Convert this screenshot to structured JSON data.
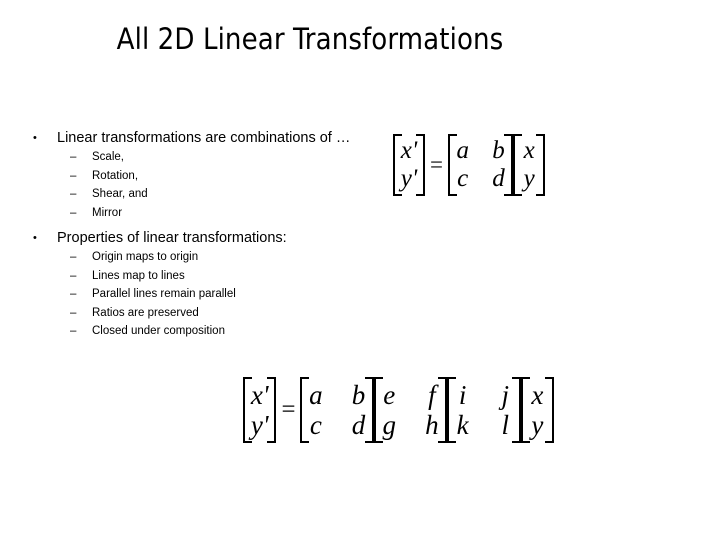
{
  "slide": {
    "title": "All 2D Linear Transformations",
    "bullets": [
      {
        "marker": "•",
        "text": "Linear transformations are combinations of …",
        "sub_marker": "–",
        "sub_items": [
          "Scale,",
          "Rotation,",
          "Shear, and",
          "Mirror"
        ]
      },
      {
        "marker": "•",
        "text": "Properties of linear transformations:",
        "sub_marker": "–",
        "sub_items": [
          "Origin maps to origin",
          "Lines map to lines",
          "Parallel lines remain parallel",
          "Ratios are preserved",
          "Closed under composition"
        ]
      }
    ]
  },
  "equations": {
    "top": {
      "lhs": {
        "rows": [
          [
            "x'"
          ],
          [
            "y'"
          ]
        ]
      },
      "operator": "=",
      "factors": [
        {
          "rows": [
            [
              "a",
              "b"
            ],
            [
              "c",
              "d"
            ]
          ]
        },
        {
          "rows": [
            [
              "x"
            ],
            [
              "y"
            ]
          ]
        }
      ]
    },
    "bottom": {
      "lhs": {
        "rows": [
          [
            "x'"
          ],
          [
            "y'"
          ]
        ]
      },
      "operator": "=",
      "factors": [
        {
          "rows": [
            [
              "a",
              "b"
            ],
            [
              "c",
              "d"
            ]
          ]
        },
        {
          "rows": [
            [
              "e",
              "f"
            ],
            [
              "g",
              "h"
            ]
          ]
        },
        {
          "rows": [
            [
              "i",
              "j"
            ],
            [
              "k",
              "l"
            ]
          ]
        },
        {
          "rows": [
            [
              "x"
            ],
            [
              "y"
            ]
          ]
        }
      ]
    }
  },
  "colors": {
    "background": "#ffffff",
    "text": "#000000"
  }
}
